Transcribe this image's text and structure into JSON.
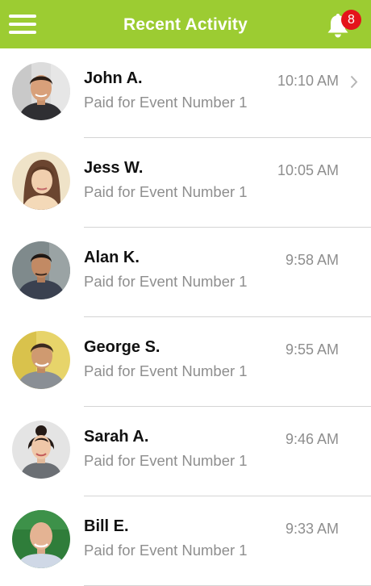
{
  "header": {
    "title": "Recent Activity",
    "menu_icon": "hamburger-menu-icon",
    "bell_icon": "bell-icon",
    "notification_count": "8",
    "background_color": "#9ccc32",
    "badge_color": "#e4141b"
  },
  "activities": [
    {
      "name": "John A.",
      "description": "Paid for Event Number 1",
      "time": "10:10 AM",
      "has_chevron": true
    },
    {
      "name": "Jess W.",
      "description": "Paid for Event Number 1",
      "time": "10:05 AM",
      "has_chevron": false
    },
    {
      "name": "Alan K.",
      "description": "Paid for Event Number 1",
      "time": "9:58 AM",
      "has_chevron": false
    },
    {
      "name": "George S.",
      "description": "Paid for Event Number 1",
      "time": "9:55 AM",
      "has_chevron": false
    },
    {
      "name": "Sarah A.",
      "description": "Paid for Event Number 1",
      "time": "9:46 AM",
      "has_chevron": false
    },
    {
      "name": "Bill E.",
      "description": "Paid for Event Number 1",
      "time": "9:33 AM",
      "has_chevron": false
    }
  ]
}
